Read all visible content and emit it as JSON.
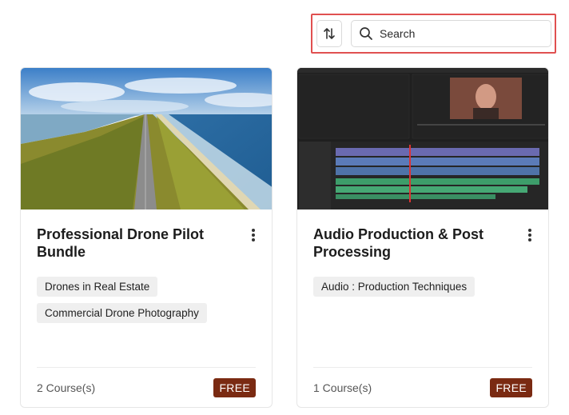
{
  "toolbar": {
    "search_placeholder": "Search",
    "sort_icon": "sort-arrows-icon",
    "search_icon": "search-icon"
  },
  "cards": [
    {
      "title": "Professional Drone Pilot Bundle",
      "tags": [
        "Drones in Real Estate",
        "Commercial Drone Photography"
      ],
      "count": "2 Course(s)",
      "badge": "FREE"
    },
    {
      "title": "Audio Production & Post Processing",
      "tags": [
        "Audio : Production Techniques"
      ],
      "count": "1 Course(s)",
      "badge": "FREE"
    }
  ],
  "colors": {
    "badge_bg": "#7a2a12",
    "highlight": "#e05050",
    "tag_bg": "#efefef"
  }
}
